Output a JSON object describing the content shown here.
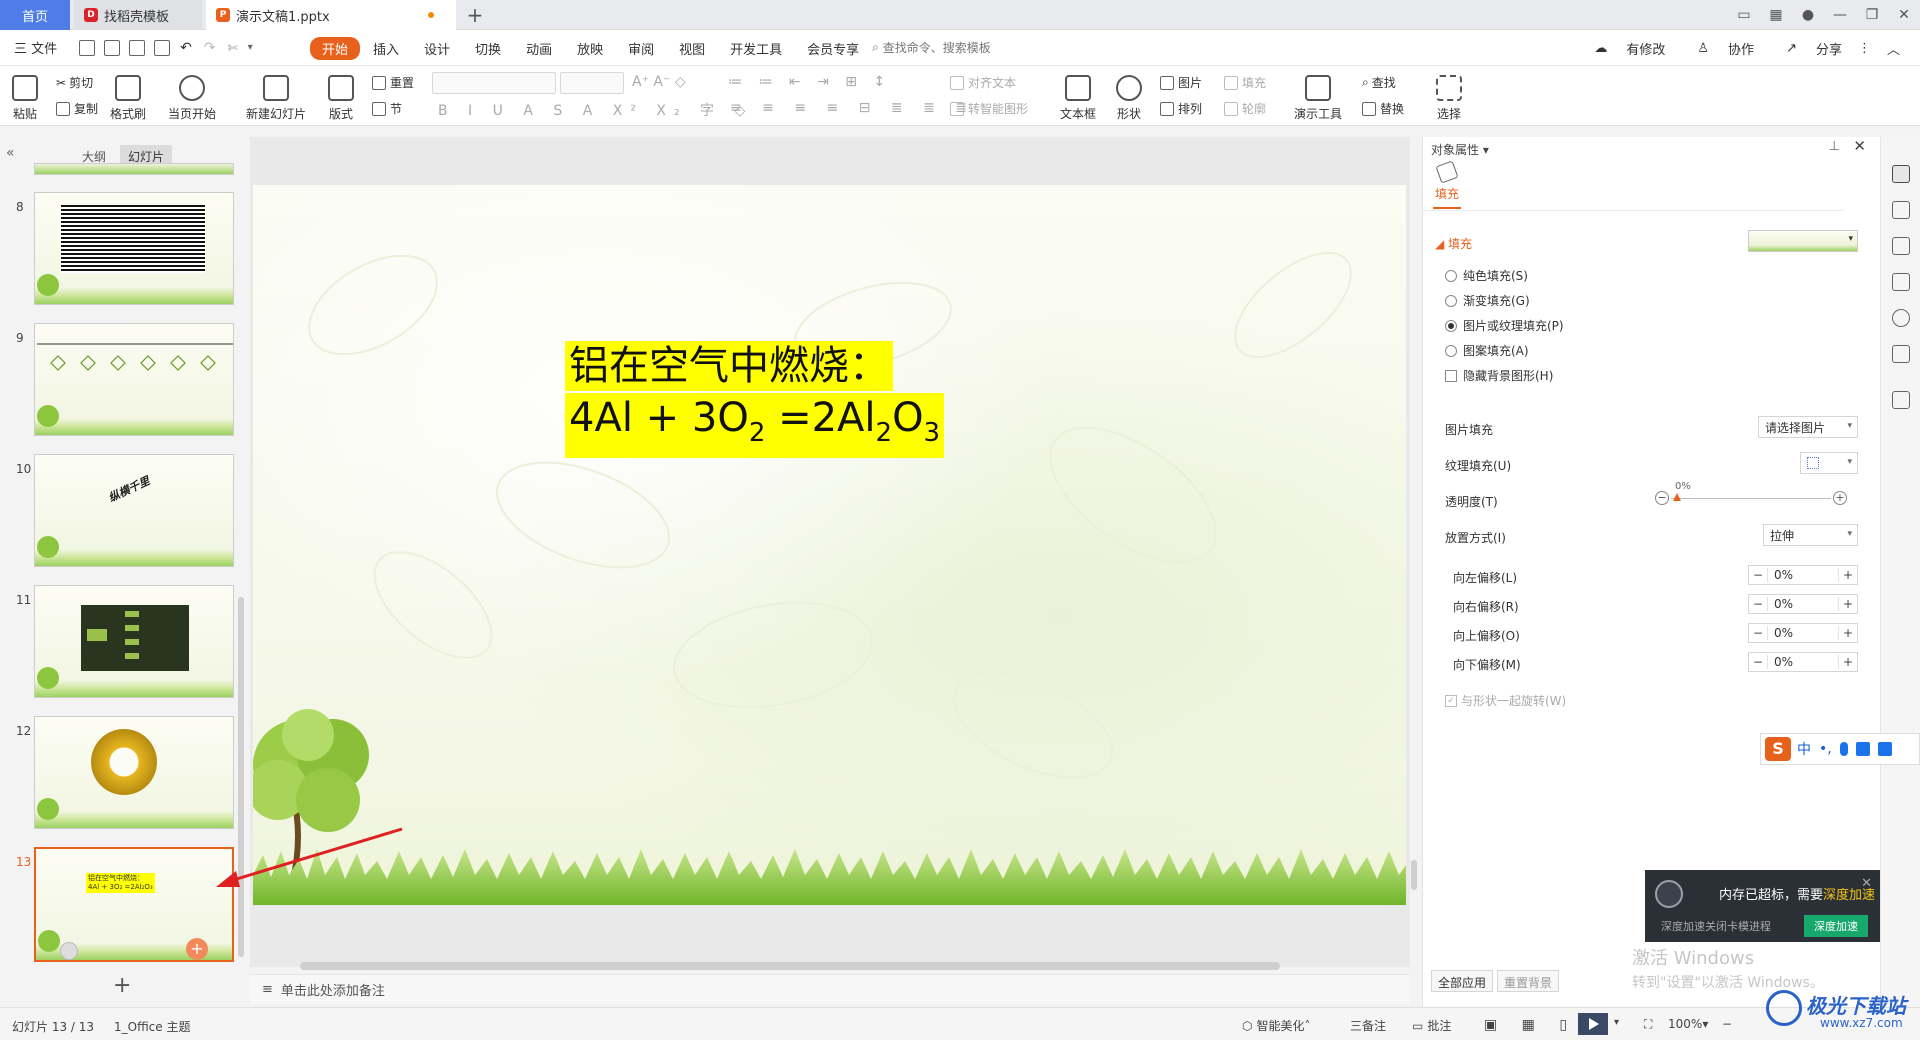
{
  "titlebar": {
    "home_tab": "首页",
    "template_tab": "找稻壳模板",
    "doc_tab": "演示文稿1.pptx",
    "new_tab": "+"
  },
  "menubar": {
    "file": "三 文件",
    "tabs": [
      "开始",
      "插入",
      "设计",
      "切换",
      "动画",
      "放映",
      "审阅",
      "视图",
      "开发工具",
      "会员专享"
    ],
    "active_tab": "开始",
    "search": "查找命令、搜索模板",
    "right": [
      "有修改",
      "协作",
      "分享"
    ]
  },
  "ribbon": {
    "paste": "粘贴",
    "cut": "剪切",
    "copy": "复制",
    "format_painter": "格式刷",
    "start_from_current": "当页开始",
    "new_slide": "新建幻灯片",
    "layout": "版式",
    "reset": "重置",
    "section": "节",
    "align_text": "对齐文本",
    "smart_art": "转智能图形",
    "textbox": "文本框",
    "shape": "形状",
    "picture": "图片",
    "arrange": "排列",
    "fill": "填充",
    "outline": "轮廓",
    "presentation_tools": "演示工具",
    "find": "查找",
    "replace": "替换",
    "select": "选择"
  },
  "left_panel": {
    "tab_outline": "大纲",
    "tab_slides": "幻灯片",
    "slides": [
      {
        "num": "8"
      },
      {
        "num": "9"
      },
      {
        "num": "10",
        "caption": "纵横千里"
      },
      {
        "num": "11"
      },
      {
        "num": "12"
      },
      {
        "num": "13",
        "caption1": "铝在空气中燃烧：",
        "caption2": "4Al + 3O₂ =2Al₂O₃"
      }
    ],
    "add": "+"
  },
  "slide": {
    "line1": "铝在空气中燃烧：",
    "line2_a": "4Al + 3O",
    "line2_sub1": "2",
    "line2_b": " =2Al",
    "line2_sub2": "2",
    "line2_c": "O",
    "line2_sub3": "3",
    "highlight": "#ffff00"
  },
  "notes": {
    "placeholder": "单击此处添加备注"
  },
  "right_panel": {
    "title": "对象属性",
    "tab_fill": "填充",
    "section_fill": "填充",
    "options": [
      "纯色填充(S)",
      "渐变填充(G)",
      "图片或纹理填充(P)",
      "图案填充(A)"
    ],
    "selected_option": "图片或纹理填充(P)",
    "hide_bg": "隐藏背景图形(H)",
    "picture_fill_label": "图片填充",
    "picture_fill_value": "请选择图片",
    "texture_fill_label": "纹理填充(U)",
    "transparency_label": "透明度(T)",
    "transparency_value": "0%",
    "placement_label": "放置方式(I)",
    "placement_value": "拉伸",
    "offsets": [
      {
        "label": "向左偏移(L)",
        "value": "0%"
      },
      {
        "label": "向右偏移(R)",
        "value": "0%"
      },
      {
        "label": "向上偏移(O)",
        "value": "0%"
      },
      {
        "label": "向下偏移(M)",
        "value": "0%"
      }
    ],
    "rotate_with_shape": "与形状一起旋转(W)",
    "apply_all": "全部应用",
    "reset_bg": "重置背景"
  },
  "ime": {
    "logo": "S",
    "mode": "中"
  },
  "toast": {
    "msg_a": "内存已超标，需要",
    "msg_b": "深度加速",
    "sub": "深度加速关闭卡模进程",
    "button": "深度加速"
  },
  "watermark": {
    "line1": "激活 Windows",
    "line2": "转到\"设置\"以激活 Windows。"
  },
  "statusbar": {
    "slide_count": "幻灯片 13 / 13",
    "theme": "1_Office 主题",
    "smart_beautify": "智能美化",
    "notes": "三备注",
    "comments": "批注",
    "zoom": "100%"
  },
  "logo": {
    "name": "极光下载站",
    "url": "www.xz7.com"
  }
}
